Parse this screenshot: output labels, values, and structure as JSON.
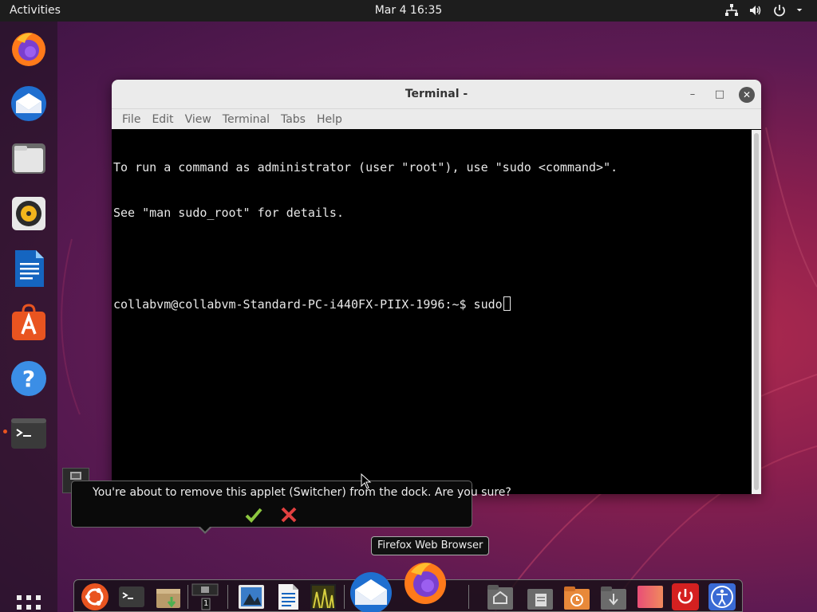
{
  "topbar": {
    "activities": "Activities",
    "clock": "Mar 4  16:35",
    "tray_icons": [
      "network-icon",
      "volume-icon",
      "power-icon",
      "chevron-down-icon"
    ]
  },
  "dock_left": {
    "apps": [
      {
        "name": "Firefox",
        "icon": "firefox-icon"
      },
      {
        "name": "Thunderbird Mail",
        "icon": "thunderbird-icon"
      },
      {
        "name": "Files",
        "icon": "files-icon"
      },
      {
        "name": "Rhythmbox",
        "icon": "rhythmbox-icon"
      },
      {
        "name": "LibreOffice Writer",
        "icon": "writer-icon"
      },
      {
        "name": "Ubuntu Software",
        "icon": "software-icon"
      },
      {
        "name": "Help",
        "icon": "help-icon"
      },
      {
        "name": "Terminal",
        "icon": "terminal-icon",
        "running": true
      }
    ],
    "show_apps_icon": "grid-icon"
  },
  "terminal": {
    "title": "Terminal -",
    "menu": [
      "File",
      "Edit",
      "View",
      "Terminal",
      "Tabs",
      "Help"
    ],
    "lines": [
      "To run a command as administrator (user \"root\"), use \"sudo <command>\".",
      "See \"man sudo_root\" for details.",
      "",
      "collabvm@collabvm-Standard-PC-i440FX-PIIX-1996:~$ sudo"
    ],
    "controls": {
      "minimize": "–",
      "maximize": "□",
      "close": "✕"
    }
  },
  "confirm": {
    "message": "You're about to remove this applet (Switcher) from the dock. Are you sure?",
    "yes_icon": "checkmark-icon",
    "no_icon": "cross-icon",
    "colors": {
      "yes": "#8cc63f",
      "no": "#e04040"
    }
  },
  "tooltip": {
    "text": "Firefox Web Browser"
  },
  "dock_bottom": {
    "workspace_number": "1",
    "items": [
      "ubuntu-logo-icon",
      "terminal-icon",
      "archive-manager-icon",
      "workspace-switcher-icon",
      "image-viewer-icon",
      "writer-icon",
      "photo-icon",
      "thunderbird-icon",
      "firefox-icon",
      "home-folder-icon",
      "documents-folder-icon",
      "recent-folder-icon",
      "downloads-folder-icon",
      "color-icon",
      "shutdown-icon",
      "accessibility-icon"
    ]
  },
  "colors": {
    "accent": "#e95420",
    "topbar": "#1d1d1d",
    "terminal_bg": "#000000",
    "terminal_fg": "#e8e8e8"
  }
}
